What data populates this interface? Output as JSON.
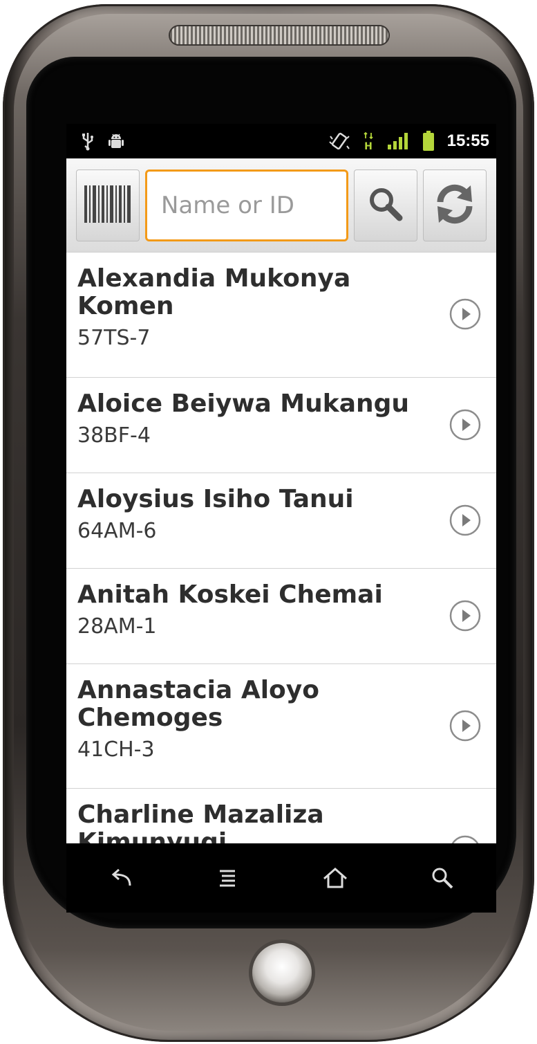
{
  "statusbar": {
    "icons_left": [
      "usb-icon",
      "android-debug-icon"
    ],
    "icons_right": [
      "vibrate-icon",
      "hspa-data-icon",
      "signal-icon",
      "battery-icon"
    ],
    "time": "15:55",
    "accent_color": "#b4d63a"
  },
  "toolbar": {
    "search_placeholder": "Name or ID",
    "search_value": "",
    "focus_color": "#f39a18"
  },
  "people": [
    {
      "name": "Alexandia Mukonya Komen",
      "id": "57TS-7"
    },
    {
      "name": "Aloice Beiywa Mukangu",
      "id": "38BF-4"
    },
    {
      "name": "Aloysius Isiho Tanui",
      "id": "64AM-6"
    },
    {
      "name": "Anitah Koskei Chemai",
      "id": "28AM-1"
    },
    {
      "name": "Annastacia Aloyo Chemoges",
      "id": "41CH-3"
    },
    {
      "name": "Charline Mazaliza Kimunyugi",
      "id": ""
    }
  ],
  "navbar": {
    "icons": [
      "back-icon",
      "menu-icon",
      "home-icon",
      "search-icon"
    ]
  }
}
